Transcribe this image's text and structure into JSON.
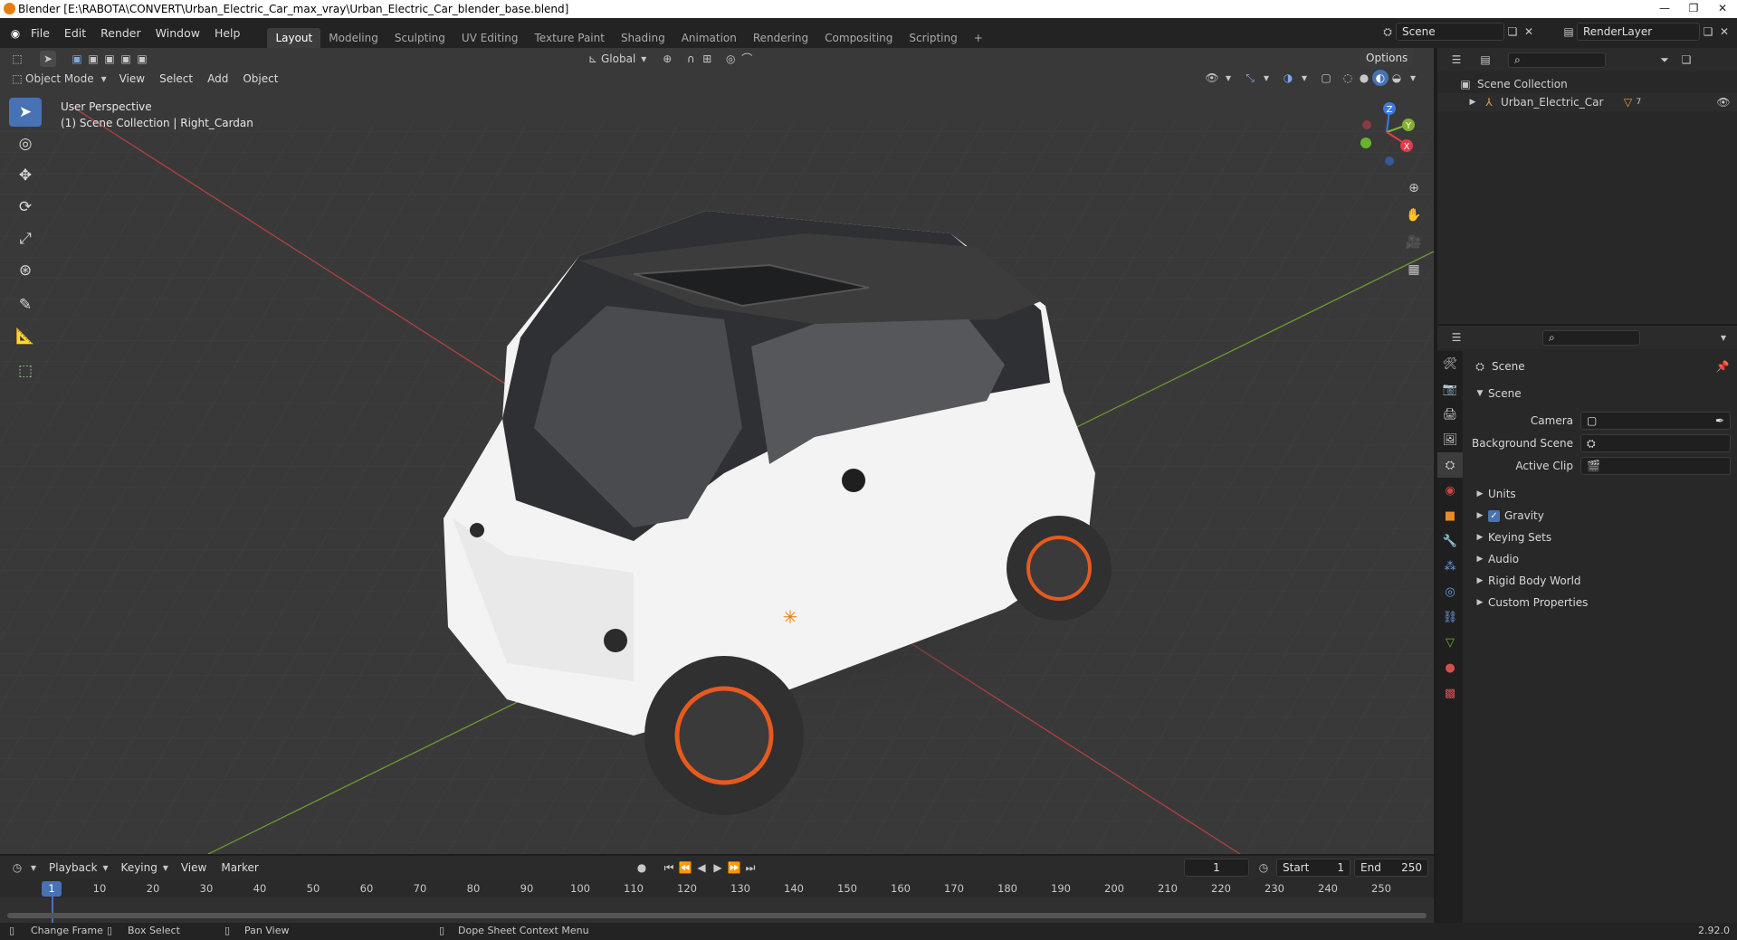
{
  "titlebar": {
    "title": "Blender [E:\\RABOTA\\CONVERT\\Urban_Electric_Car_max_vray\\Urban_Electric_Car_blender_base.blend]"
  },
  "menu": [
    "File",
    "Edit",
    "Render",
    "Window",
    "Help"
  ],
  "workspaces": [
    "Layout",
    "Modeling",
    "Sculpting",
    "UV Editing",
    "Texture Paint",
    "Shading",
    "Animation",
    "Rendering",
    "Compositing",
    "Scripting"
  ],
  "scene_field": "Scene",
  "renderlayer_field": "RenderLayer",
  "viewport": {
    "transform_orientation": "Global",
    "options_label": "Options",
    "mode": "Object Mode",
    "menus": [
      "View",
      "Select",
      "Add",
      "Object"
    ],
    "info_line1": "User Perspective",
    "info_line2": "(1) Scene Collection | Right_Cardan",
    "gizmo": {
      "z": "Z",
      "y": "Y",
      "x": "X"
    }
  },
  "outliner": {
    "root": "Scene Collection",
    "items": [
      {
        "label": "Urban_Electric_Car",
        "badge": "7"
      }
    ]
  },
  "properties": {
    "header": "Scene",
    "panel": "Scene",
    "fields": [
      {
        "label": "Camera",
        "value": ""
      },
      {
        "label": "Background Scene",
        "value": ""
      },
      {
        "label": "Active Clip",
        "value": ""
      }
    ],
    "sections": [
      "Units",
      "Gravity",
      "Keying Sets",
      "Audio",
      "Rigid Body World",
      "Custom Properties"
    ],
    "gravity_checked": true
  },
  "timeline": {
    "menus": [
      "Playback",
      "Keying",
      "View",
      "Marker"
    ],
    "current_frame": "1",
    "start_label": "Start",
    "start_value": "1",
    "end_label": "End",
    "end_value": "250",
    "ticks": [
      "1",
      "10",
      "20",
      "30",
      "40",
      "50",
      "60",
      "70",
      "80",
      "90",
      "100",
      "110",
      "120",
      "130",
      "140",
      "150",
      "160",
      "170",
      "180",
      "190",
      "200",
      "210",
      "220",
      "230",
      "240",
      "250"
    ]
  },
  "statusbar": {
    "change_frame": "Change Frame",
    "box_select": "Box Select",
    "pan_view": "Pan View",
    "context_menu": "Dope Sheet Context Menu",
    "version": "2.92.0"
  },
  "colors": {
    "accent": "#4772b3",
    "background": "#393939",
    "panel": "#282828",
    "orange": "#e87d0d"
  }
}
